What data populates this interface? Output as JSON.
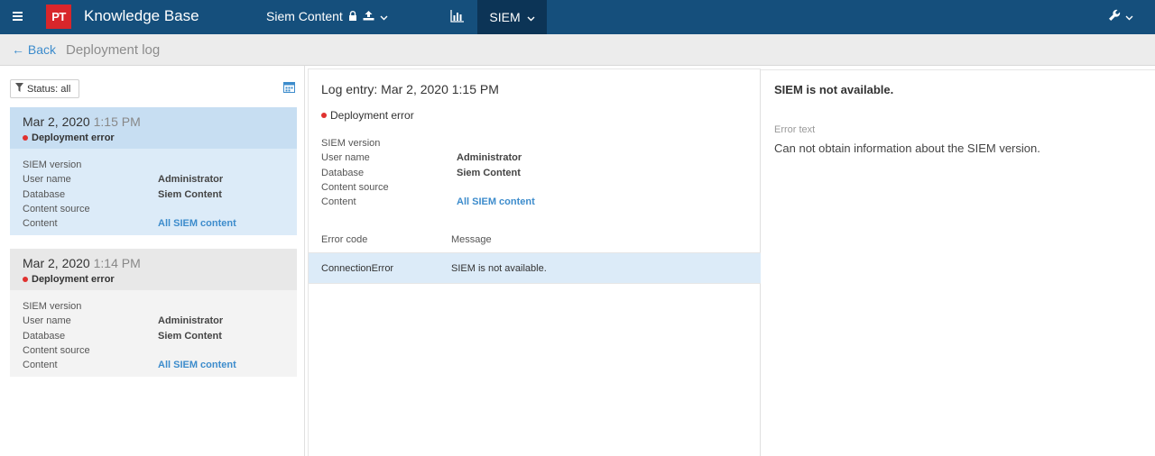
{
  "header": {
    "logo_text": "PT",
    "app_title": "Knowledge Base",
    "database_name": "Siem Content",
    "siem_tab_label": "SIEM",
    "accent": "#154f7c",
    "logo_color": "#d8262b"
  },
  "subheader": {
    "back_label": "← Back",
    "page_title": "Deployment log"
  },
  "left_panel": {
    "filter_label": "Status: all",
    "entries": [
      {
        "date": "Mar 2, 2020",
        "time": "1:15 PM",
        "status": "Deployment error",
        "selected": true,
        "fields": [
          {
            "key": "SIEM version",
            "value": ""
          },
          {
            "key": "User name",
            "value": "Administrator"
          },
          {
            "key": "Database",
            "value": "Siem Content"
          },
          {
            "key": "Content source",
            "value": ""
          },
          {
            "key": "Content",
            "value": "All SIEM content"
          }
        ]
      },
      {
        "date": "Mar 2, 2020",
        "time": "1:14 PM",
        "status": "Deployment error",
        "selected": false,
        "fields": [
          {
            "key": "SIEM version",
            "value": ""
          },
          {
            "key": "User name",
            "value": "Administrator"
          },
          {
            "key": "Database",
            "value": "Siem Content"
          },
          {
            "key": "Content source",
            "value": ""
          },
          {
            "key": "Content",
            "value": "All SIEM content"
          }
        ]
      }
    ]
  },
  "detail": {
    "title": "Log entry: Mar 2, 2020 1:15 PM",
    "status": "Deployment error",
    "fields": [
      {
        "key": "SIEM version",
        "value": ""
      },
      {
        "key": "User name",
        "value": "Administrator"
      },
      {
        "key": "Database",
        "value": "Siem Content"
      },
      {
        "key": "Content source",
        "value": ""
      },
      {
        "key": "Content",
        "value": "All SIEM content"
      }
    ],
    "error_table": {
      "col_code": "Error code",
      "col_message": "Message",
      "rows": [
        {
          "code": "ConnectionError",
          "message": "SIEM is not available."
        }
      ]
    }
  },
  "error_panel": {
    "title": "SIEM is not available.",
    "label": "Error text",
    "text": "Can not obtain information about the SIEM version."
  },
  "status_color": "#e0312f"
}
